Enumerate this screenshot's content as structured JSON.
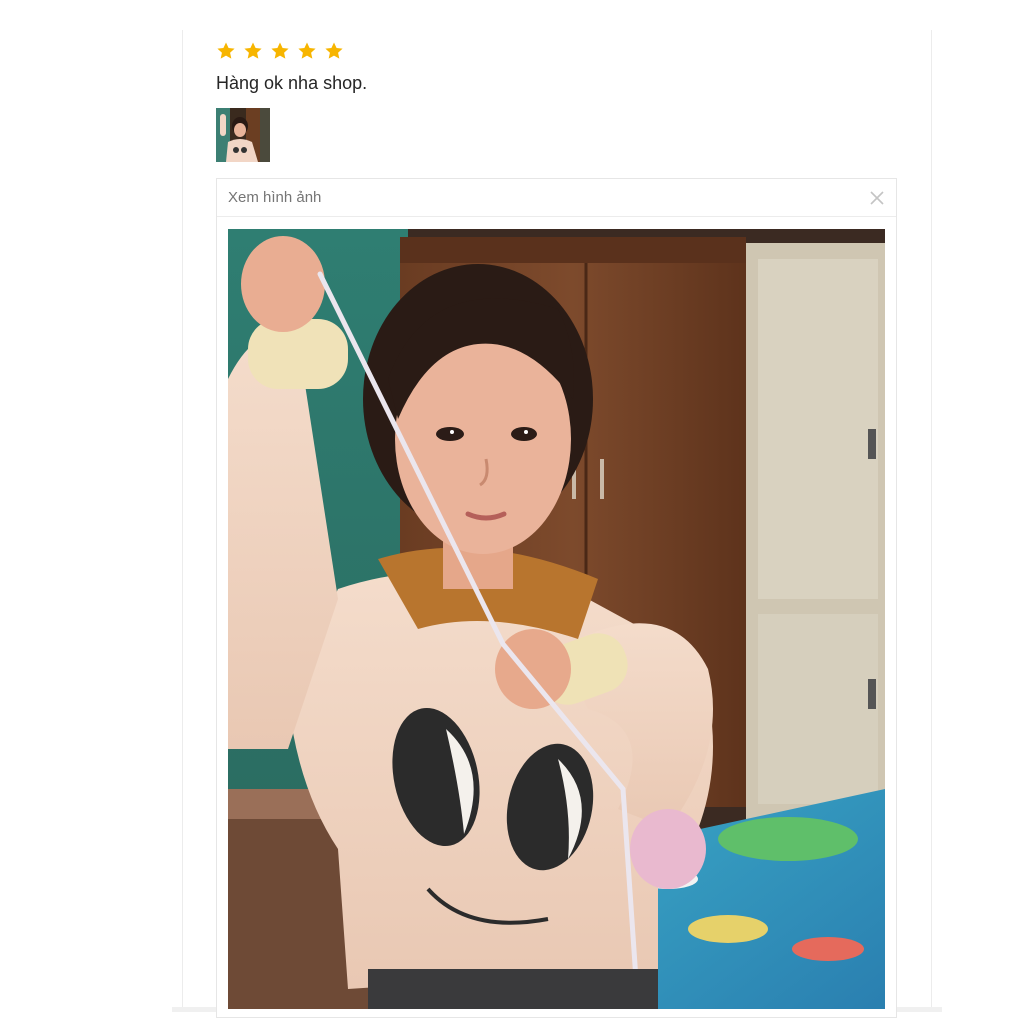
{
  "review": {
    "rating": 5,
    "rating_max": 5,
    "star_color": "#f7b500",
    "comment": "Hàng ok nha shop."
  },
  "thumbnail": {
    "icon": "photo-thumbnail"
  },
  "viewer": {
    "title": "Xem hình ảnh",
    "close_icon": "close-icon"
  }
}
